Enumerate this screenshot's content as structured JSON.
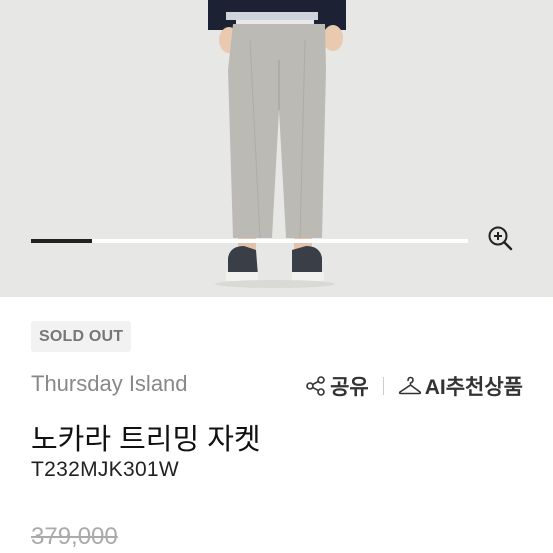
{
  "product": {
    "badge": "SOLD OUT",
    "brand": "Thursday Island",
    "name": "노카라 트리밍 자켓",
    "code": "T232MJK301W",
    "original_price": "379,000"
  },
  "gallery": {
    "progress_fraction": 0.14
  },
  "actions": {
    "share_label": "공유",
    "ai_label": "AI추천상품"
  },
  "icons": {
    "zoom": "zoom-in-icon",
    "share": "share-icon",
    "hanger": "hanger-icon"
  },
  "colors": {
    "image_background": "#e7e7e5",
    "progress_fill": "#222222",
    "badge_bg": "#f2f2f2",
    "badge_text": "#777777",
    "strike_price": "#aaaaaa"
  }
}
